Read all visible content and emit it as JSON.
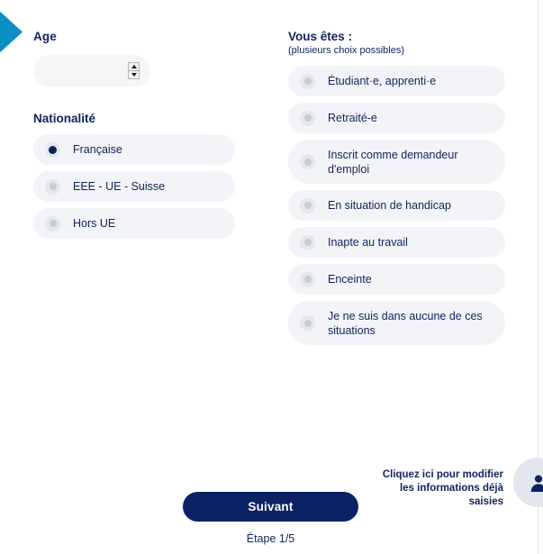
{
  "decor": {
    "chevron_color": "#0b8fc4",
    "accent_navy": "#10235c",
    "pill_bg": "#f2f4f7"
  },
  "left_column": {
    "age": {
      "label": "Age",
      "value": "",
      "placeholder": "",
      "spinner_up_icon": "triangle-up-icon",
      "spinner_down_icon": "triangle-down-icon"
    },
    "nationality": {
      "label": "Nationalité",
      "options": [
        {
          "label": "Française",
          "selected": true
        },
        {
          "label": "EEE - UE - Suisse",
          "selected": false
        },
        {
          "label": "Hors UE",
          "selected": false
        }
      ]
    }
  },
  "right_column": {
    "situation": {
      "label": "Vous êtes :",
      "hint": "(plusieurs choix possibles)",
      "options": [
        {
          "label": "Étudiant·e, apprenti·e",
          "selected": false,
          "multiline": false
        },
        {
          "label": "Retraité-e",
          "selected": false,
          "multiline": false
        },
        {
          "label": "Inscrit comme demandeur d'emploi",
          "selected": false,
          "multiline": true
        },
        {
          "label": "En situation de handicap",
          "selected": false,
          "multiline": false
        },
        {
          "label": "Inapte au travail",
          "selected": false,
          "multiline": false
        },
        {
          "label": "Enceinte",
          "selected": false,
          "multiline": false
        },
        {
          "label": "Je ne suis dans aucune de ces situations",
          "selected": false,
          "multiline": true
        }
      ]
    }
  },
  "footer": {
    "next_label": "Suivant",
    "step_label": "Étape 1/5",
    "modify_link": "Cliquez ici pour modifier les informations déjà saisies",
    "avatar_icon": "user-avatar-icon"
  }
}
